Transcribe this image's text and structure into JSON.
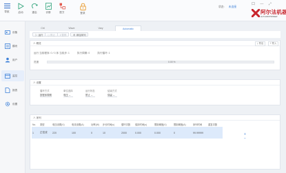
{
  "toolbar": {
    "buttons": [
      {
        "icon": "hamburger-menu-icon",
        "label": "导航"
      },
      {
        "icon": "play-icon",
        "label": "启动"
      },
      {
        "icon": "refresh-icon",
        "label": "重启"
      },
      {
        "icon": "chart-icon",
        "label": "诊断"
      },
      {
        "icon": "network-icon",
        "label": "配方"
      },
      {
        "icon": "lock-icon",
        "label": "登录"
      }
    ],
    "status_label": "状态:",
    "status_value": "未连接",
    "window_controls": "口  —  ⤢",
    "brand_name": "阿尔法机器",
    "brand_sub": "ALTHORPOWER",
    "brand_color": "#c8262d"
  },
  "sidebar": {
    "items": [
      {
        "icon": "device-icon",
        "label": "设备"
      },
      {
        "icon": "module-icon",
        "label": "模块"
      },
      {
        "icon": "user-icon",
        "label": "用户"
      },
      {
        "icon": "monitor-icon",
        "label": "监控"
      },
      {
        "icon": "document-icon",
        "label": "报表"
      },
      {
        "icon": "gear-icon",
        "label": "设置"
      }
    ]
  },
  "tabs": [
    "Ctrl",
    "Wave",
    "Vary",
    "Automatic"
  ],
  "subbar": {
    "buttons": [
      "▷ 运行",
      "◻ 停止",
      "‖ 暂停",
      "⊕ 添加序列"
    ]
  },
  "run_panel": {
    "title": "∧ 概览",
    "export_label": "导出",
    "import_label": "导入",
    "status_items": [
      "运行 当前程序: 0 / 0 序 当前步: 1",
      "执行周期: 0",
      "执行循环: 1"
    ],
    "progress_label": "进度",
    "progress_text": "0.00 %",
    "progress_value": 0.0
  },
  "settings_panel": {
    "title": "∧ 设置",
    "fields": [
      {
        "label": "循环方式",
        "value": "按程序周期"
      },
      {
        "label": "单位选择",
        "value": "电压 ⌄"
      },
      {
        "label": "运行状态",
        "value": "禁止 ⌄"
      },
      {
        "label": "结束方式",
        "value": "保留 ⌄"
      }
    ]
  },
  "steps_panel": {
    "title": "∧ 序列",
    "headers": [
      "No.",
      "类型",
      "电压设置(V)",
      "电流设置(A)",
      "功率(W)",
      "步长时间(s)",
      "循环次数",
      "保持时间(s)",
      "限制阈值(V)",
      "限制阈值(A)",
      "序列时间",
      "重复次数"
    ],
    "rows": [
      [
        "1",
        "正弦波",
        "220",
        "100",
        "0",
        "10",
        "2000",
        "0.000",
        "0.000",
        "0",
        "99.99999"
      ]
    ],
    "add_label": "+",
    "remove_label": "−"
  },
  "accent_color": "#3b7fd8"
}
